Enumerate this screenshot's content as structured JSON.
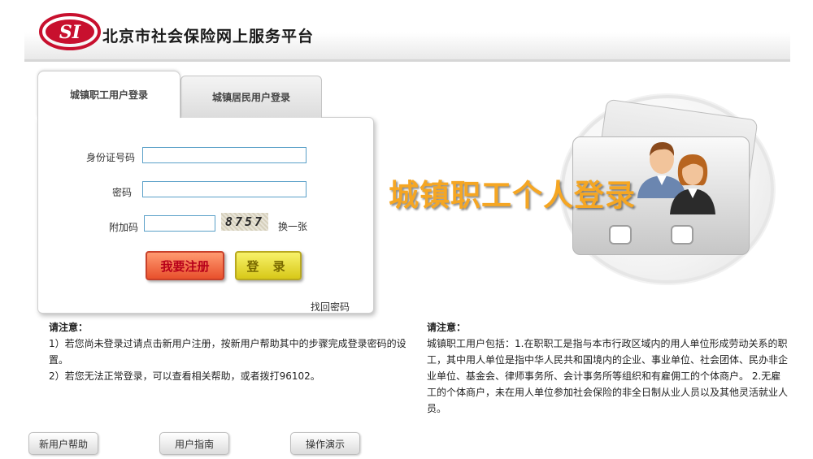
{
  "header": {
    "logo_text": "SI",
    "site_title": "北京市社会保险网上服务平台"
  },
  "tabs": [
    {
      "label": "城镇职工用户登录",
      "active": true
    },
    {
      "label": "城镇居民用户登录",
      "active": false
    }
  ],
  "form": {
    "id_label": "身份证号码",
    "id_value": "",
    "password_label": "密码",
    "password_value": "",
    "captcha_label": "附加码",
    "captcha_value": "",
    "captcha_image_text": "8757",
    "refresh_label": "换一张",
    "register_label": "我要注册",
    "login_label": "登 录",
    "forgot_label": "找回密码"
  },
  "promo": {
    "text": "城镇职工个人登录",
    "icon": "people-icon"
  },
  "notice_left": {
    "title": "请注意：",
    "line1": "1）若您尚未登录过请点击新用户注册，按新用户帮助其中的步骤完成登录密码的设置。",
    "line2": "2）若您无法正常登录，可以查看相关帮助，或者拨打96102。"
  },
  "notice_right": {
    "title": "请注意：",
    "body": "城镇职工用户包括：1.在职职工是指与本市行政区域内的用人单位形成劳动关系的职工，其中用人单位是指中华人民共和国境内的企业、事业单位、社会团体、民办非企业单位、基金会、律师事务所、会计事务所等组织和有雇佣工的个体商户。 2.无雇工的个体商户，未在用人单位参加社会保险的非全日制从业人员以及其他灵活就业人员。"
  },
  "bottom_buttons": {
    "help": "新用户帮助",
    "guide": "用户指南",
    "demo": "操作演示"
  },
  "colors": {
    "logo_red": "#c8102e",
    "promo_orange": "#f5a623",
    "input_border": "#5aa0c8",
    "register_red": "#e8502c",
    "login_yellow": "#d8c818"
  }
}
